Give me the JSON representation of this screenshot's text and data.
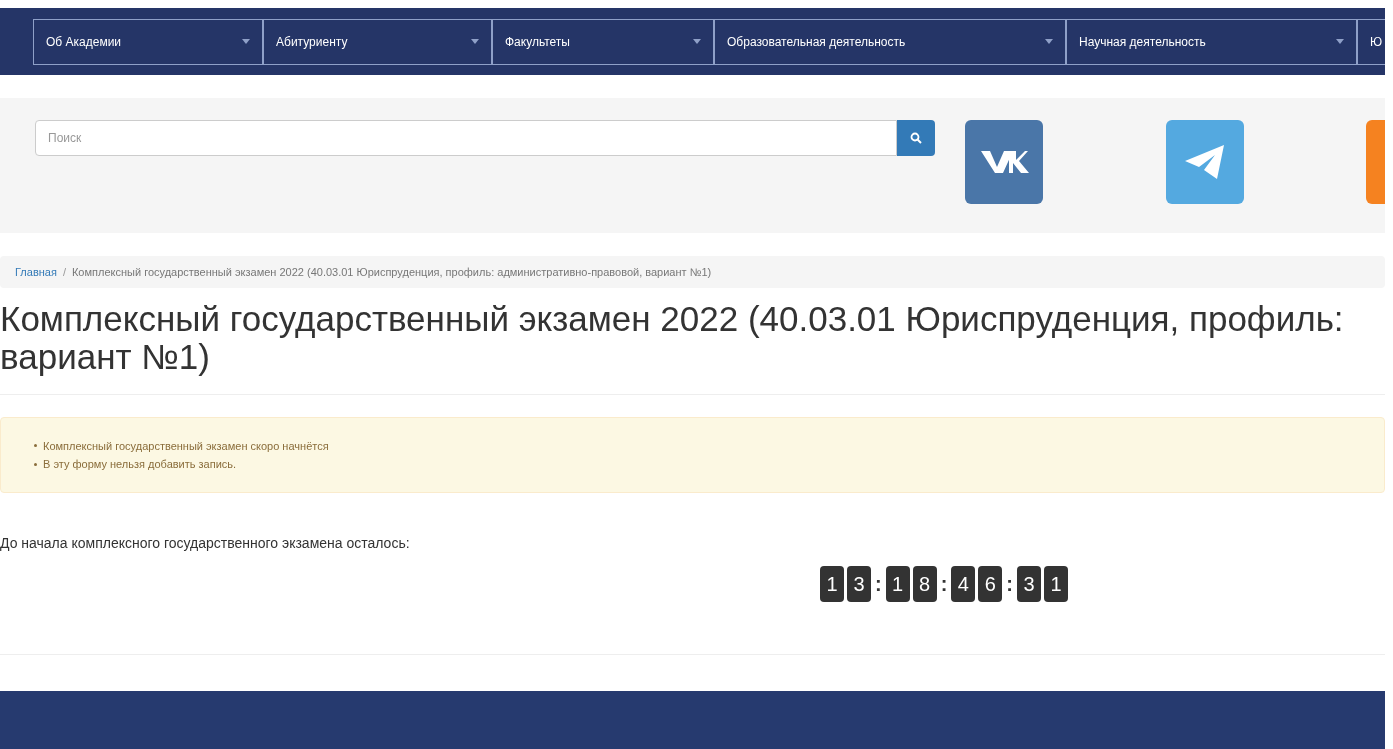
{
  "nav": [
    {
      "label": "Об Академии"
    },
    {
      "label": "Абитуриенту"
    },
    {
      "label": "Факультеты"
    },
    {
      "label": "Образовательная деятельность"
    },
    {
      "label": "Научная деятельность"
    },
    {
      "label": "Ю"
    }
  ],
  "search": {
    "placeholder": "Поиск"
  },
  "breadcrumb": {
    "items": [
      "Главная",
      "Комплексный государственный экзамен 2022 (40.03.01 Юриспруденция, профиль: административно-правовой, вариант №1)"
    ],
    "separator": "/"
  },
  "title_lines": [
    "Комплексный государственный экзамен 2022 (40.03.01 Юриспруденция, профиль:",
    "вариант №1)"
  ],
  "alert": [
    "Комплексный государственный экзамен скоро начнётся",
    "В эту форму нельзя добавить запись."
  ],
  "countdown_label": "До начала комплексного государственного экзамена осталось:",
  "countdown": {
    "groups": [
      [
        "1",
        "3"
      ],
      [
        "1",
        "8"
      ],
      [
        "4",
        "6"
      ],
      [
        "3",
        "1"
      ]
    ],
    "separator": ":"
  }
}
